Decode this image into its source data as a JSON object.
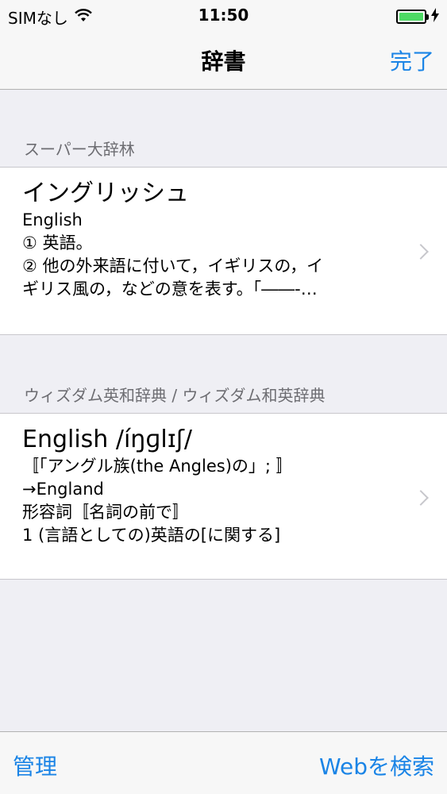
{
  "status_bar": {
    "carrier": "SIMなし",
    "time": "11:50",
    "wifi_icon": "wifi-icon",
    "battery_icon": "battery-icon",
    "charging_icon": "charging-bolt-icon",
    "battery_level": 1.0,
    "battery_color": "#4cd964"
  },
  "nav": {
    "title": "辞書",
    "done_label": "完了"
  },
  "sections": [
    {
      "header": "スーパー大辞林",
      "entry": {
        "title": "イングリッシュ",
        "lines": [
          "English",
          "① 英語。",
          "② 他の外来語に付いて，イギリスの，イ",
          "ギリス風の，などの意を表す。「――-…"
        ]
      }
    },
    {
      "header": "ウィズダム英和辞典 / ウィズダム和英辞典",
      "entry": {
        "title": "English /íŋɡlɪʃ/",
        "lines": [
          "〚「アングル族(the Angles)の」; 〛",
          "→England",
          "形容詞〚名詞の前で〛",
          "1 (言語としての)英語の[に関する]"
        ]
      }
    }
  ],
  "toolbar": {
    "manage_label": "管理",
    "web_search_label": "Webを検索"
  },
  "colors": {
    "accent": "#1a84e6",
    "background": "#efeff4"
  }
}
